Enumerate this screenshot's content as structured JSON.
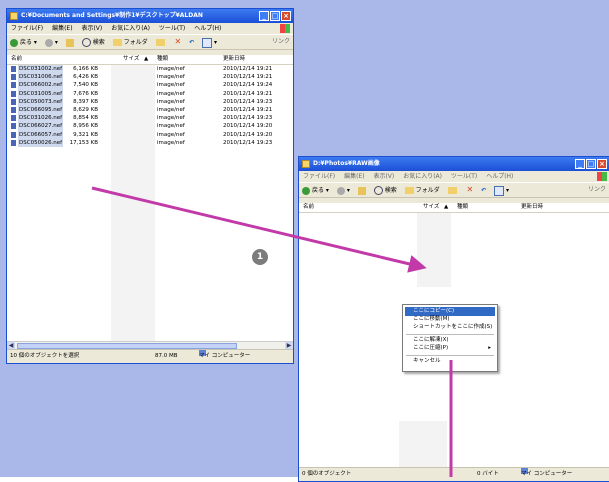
{
  "window1": {
    "title": "C:¥Documents and Settings¥制作1¥デスクトップ¥ALDAN",
    "menu": [
      "ファイル(F)",
      "編集(E)",
      "表示(V)",
      "お気に入り(A)",
      "ツール(T)",
      "ヘルプ(H)"
    ],
    "toolbar": {
      "back": "戻る",
      "search": "検索",
      "folders": "フォルダ",
      "links": "リンク"
    },
    "columns": {
      "name": "名前",
      "size": "サイズ",
      "type": "種類",
      "date": "更新日時"
    },
    "files": [
      {
        "name": "DSC031002.nef",
        "size": "6,166 KB",
        "type": "image/nef",
        "date": "2010/12/14 19:21"
      },
      {
        "name": "DSC031006.nef",
        "size": "6,426 KB",
        "type": "image/nef",
        "date": "2010/12/14 19:21"
      },
      {
        "name": "DSC066002.nef",
        "size": "7,540 KB",
        "type": "image/nef",
        "date": "2010/12/14 19:24"
      },
      {
        "name": "DSC031005.nef",
        "size": "7,676 KB",
        "type": "image/nef",
        "date": "2010/12/14 19:21"
      },
      {
        "name": "DSC050073.nef",
        "size": "8,397 KB",
        "type": "image/nef",
        "date": "2010/12/14 19:23"
      },
      {
        "name": "DSC066095.nef",
        "size": "8,629 KB",
        "type": "image/nef",
        "date": "2010/12/14 19:21"
      },
      {
        "name": "DSC031026.nef",
        "size": "8,854 KB",
        "type": "image/nef",
        "date": "2010/12/14 19:23"
      },
      {
        "name": "DSC066027.nef",
        "size": "8,956 KB",
        "type": "image/nef",
        "date": "2010/12/14 19:20"
      },
      {
        "name": "DSC066057.nef",
        "size": "9,321 KB",
        "type": "image/nef",
        "date": "2010/12/14 19:20"
      },
      {
        "name": "DSC050026.nef",
        "size": "17,153 KB",
        "type": "image/nef",
        "date": "2010/12/14 19:23"
      }
    ],
    "status": {
      "selection": "10 個のオブジェクトを選択",
      "size": "87.0 MB",
      "location": "マイ コンピューター"
    }
  },
  "window2": {
    "title": "D:¥Photos¥RAW画像",
    "menu": [
      "ファイル(F)",
      "編集(E)",
      "表示(V)",
      "お気に入り(A)",
      "ツール(T)",
      "ヘルプ(H)"
    ],
    "toolbar": {
      "back": "戻る",
      "search": "検索",
      "folders": "フォルダ",
      "links": "リンク"
    },
    "columns": {
      "name": "名前",
      "size": "サイズ",
      "type": "種類",
      "date": "更新日時"
    },
    "status": {
      "objects": "0 個のオブジェクト",
      "size": "0 バイト",
      "location": "マイ コンピューター"
    }
  },
  "context_menu": {
    "items": [
      {
        "label": "ここにコピー(C)",
        "selected": true
      },
      {
        "label": "ここに移動(M)",
        "selected": false
      },
      {
        "label": "ショートカットをここに作成(S)",
        "selected": false
      },
      {
        "label": "ここに解凍(X)",
        "selected": false
      },
      {
        "label": "ここに圧縮(P)",
        "selected": false,
        "submenu": true
      },
      {
        "label": "キャンセル",
        "selected": false
      }
    ]
  },
  "annotation": {
    "step": "1"
  },
  "colors": {
    "desktop": "#a9b8e8",
    "titlebar": "#1b4fd6",
    "arrow": "#c23aa8",
    "menu_highlight": "#316ac5"
  }
}
